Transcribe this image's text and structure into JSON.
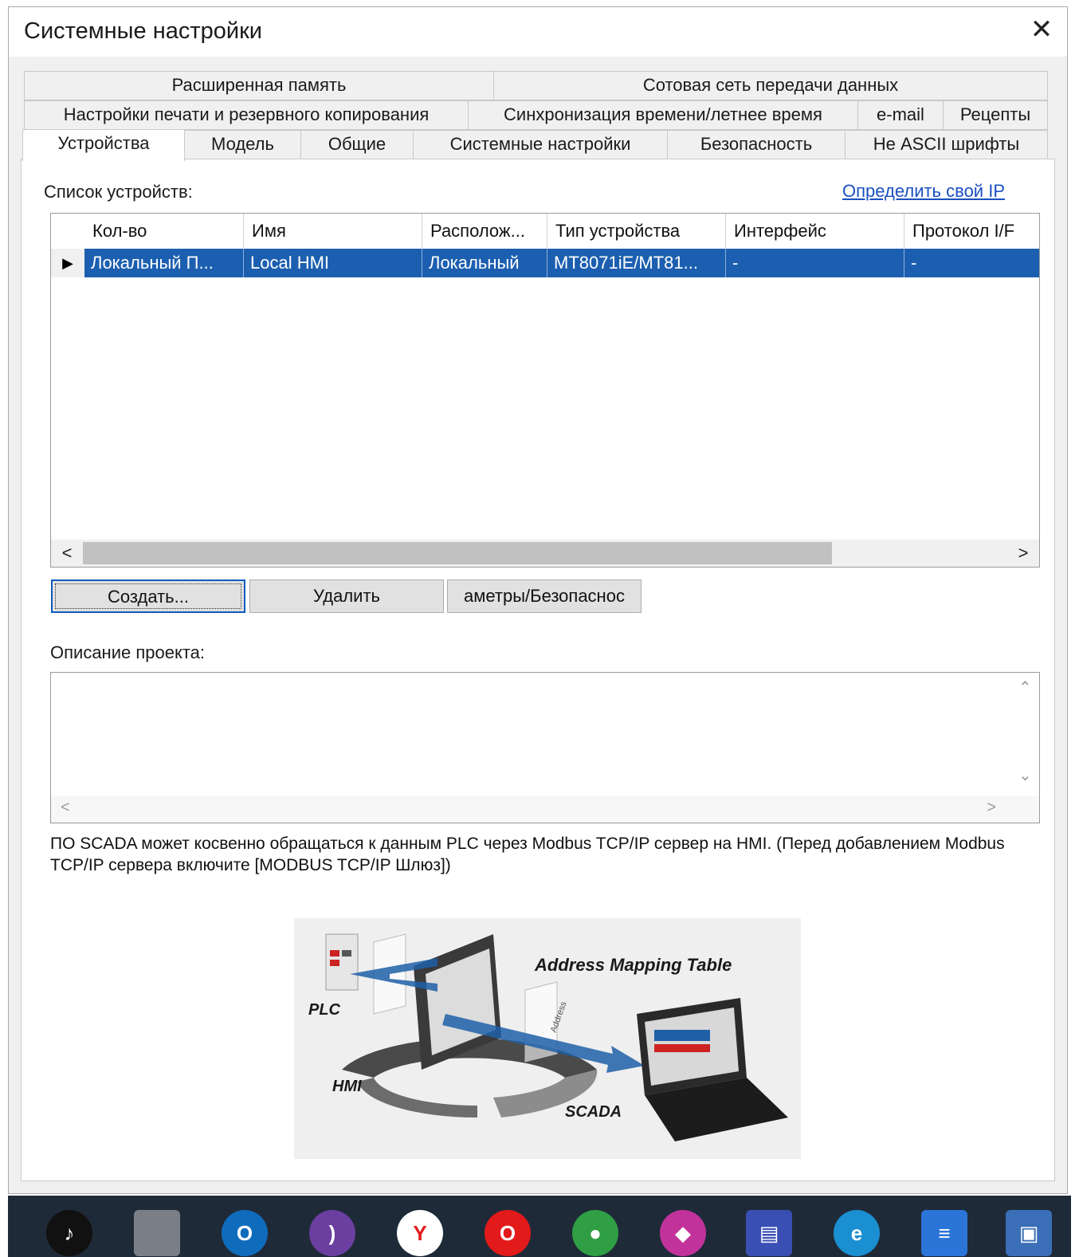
{
  "window": {
    "title": "Системные настройки",
    "close_glyph": "✕"
  },
  "tabs": {
    "row1": [
      "Расширенная память",
      "Сотовая сеть передачи данных"
    ],
    "row2": [
      "Настройки печати и резервного копирования",
      "Синхронизация времени/летнее время",
      "e-mail",
      "Рецепты"
    ],
    "row3": [
      "Устройства",
      "Модель",
      "Общие",
      "Системные настройки",
      "Безопасность",
      "Не ASCII шрифты"
    ],
    "active": "Устройства"
  },
  "devices": {
    "label": "Список устройств:",
    "find_ip_link": "Определить свой IP",
    "columns": [
      "Кол-во",
      "Имя",
      "Располож...",
      "Тип устройства",
      "Интерфейс",
      "Протокол I/F"
    ],
    "rows": [
      {
        "marker": "▶",
        "cells": [
          "Локальный П...",
          "Local HMI",
          "Локальный",
          "MT8071iE/MT81...",
          "-",
          "-"
        ]
      }
    ],
    "scroll_left": "<",
    "scroll_right": ">"
  },
  "buttons": {
    "create": "Создать...",
    "delete": "Удалить",
    "params": "аметры/Безопаснос"
  },
  "project": {
    "label": "Описание проекта:",
    "value": "",
    "up": "⌃",
    "down": "⌄",
    "left": "<",
    "right": ">"
  },
  "note": "ПО SCADA может косвенно обращаться к данным PLC через Modbus TCP/IP сервер на HMI. (Перед добавлением Modbus TCP/IP сервера включите [MODBUS TCP/IP Шлюз])",
  "diagram": {
    "title": "Address Mapping Table",
    "plc": "PLC",
    "hmi": "HMI",
    "scada": "SCADA",
    "panel_word": "Address"
  },
  "taskbar": {
    "icons": [
      {
        "name": "tiktok-icon",
        "color": "#111111",
        "glyph": "♪"
      },
      {
        "name": "usb-drive-icon",
        "color": "#7a7f87",
        "glyph": ""
      },
      {
        "name": "outlook-icon",
        "color": "#0f6cbd",
        "glyph": "O"
      },
      {
        "name": "tor-browser-icon",
        "color": "#6b3fa0",
        "glyph": ")"
      },
      {
        "name": "yandex-browser-icon",
        "color": "#ffffff",
        "glyph": "Y"
      },
      {
        "name": "opera-icon",
        "color": "#e21a1a",
        "glyph": "O"
      },
      {
        "name": "chrome-icon",
        "color": "#2f9e44",
        "glyph": "●"
      },
      {
        "name": "gem-app-icon",
        "color": "#c2329b",
        "glyph": "◆"
      },
      {
        "name": "save-disk-icon",
        "color": "#3a4fb4",
        "glyph": "▤"
      },
      {
        "name": "edge-icon",
        "color": "#1a8fd1",
        "glyph": "e"
      },
      {
        "name": "document-icon",
        "color": "#2b74d8",
        "glyph": "≡"
      },
      {
        "name": "remote-desktop-icon",
        "color": "#3a6fb8",
        "glyph": "▣"
      }
    ]
  }
}
